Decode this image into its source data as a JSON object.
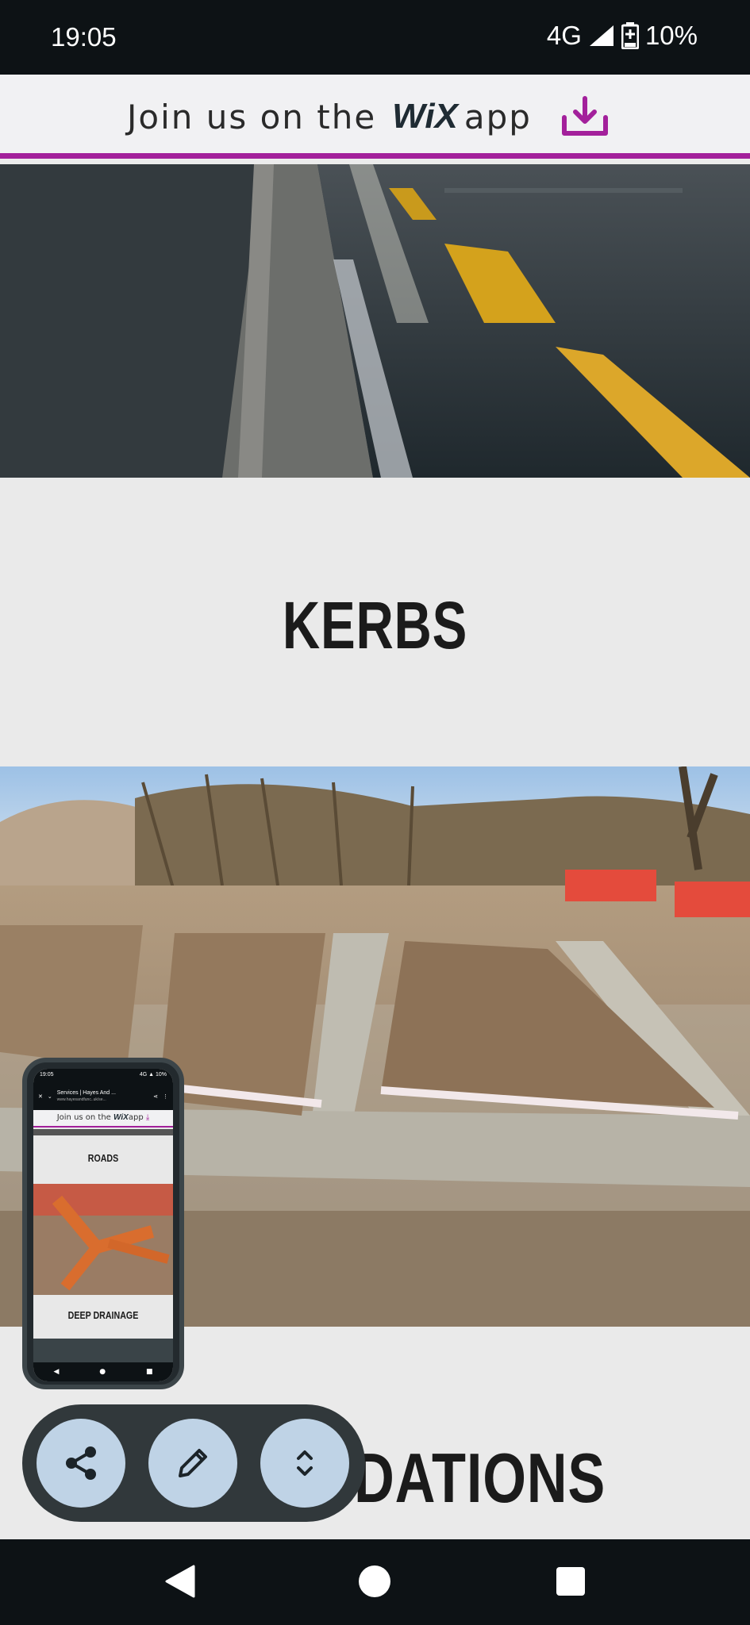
{
  "status_bar": {
    "time": "19:05",
    "network": "4G",
    "battery": "10%"
  },
  "wix_banner": {
    "text_prefix": "Join us on the",
    "logo": "WiX",
    "text_suffix": "app",
    "icon": "download-icon",
    "accent_color": "#a3209b"
  },
  "sections": [
    {
      "image": "road-kerb-photo"
    },
    {
      "title": "KERBS"
    },
    {
      "image": "foundations-trench-photo"
    },
    {
      "title": "DATIONS"
    }
  ],
  "mini_preview": {
    "status_time": "19:05",
    "status_right": "4G ▲ 10%",
    "tab_title": "Services | Hayes And ...",
    "tab_url": "www.hayesandfunc..uk/se...",
    "banner_prefix": "Join us on the",
    "banner_logo": "WiX",
    "banner_suffix": "app",
    "label_roads": "ROADS",
    "label_drainage": "DEEP DRAINAGE"
  },
  "fab_actions": [
    {
      "icon": "share-icon"
    },
    {
      "icon": "edit-icon"
    },
    {
      "icon": "expand-icon"
    }
  ],
  "nav_bar": {
    "back": "back-icon",
    "home": "home-icon",
    "recents": "recents-icon"
  }
}
